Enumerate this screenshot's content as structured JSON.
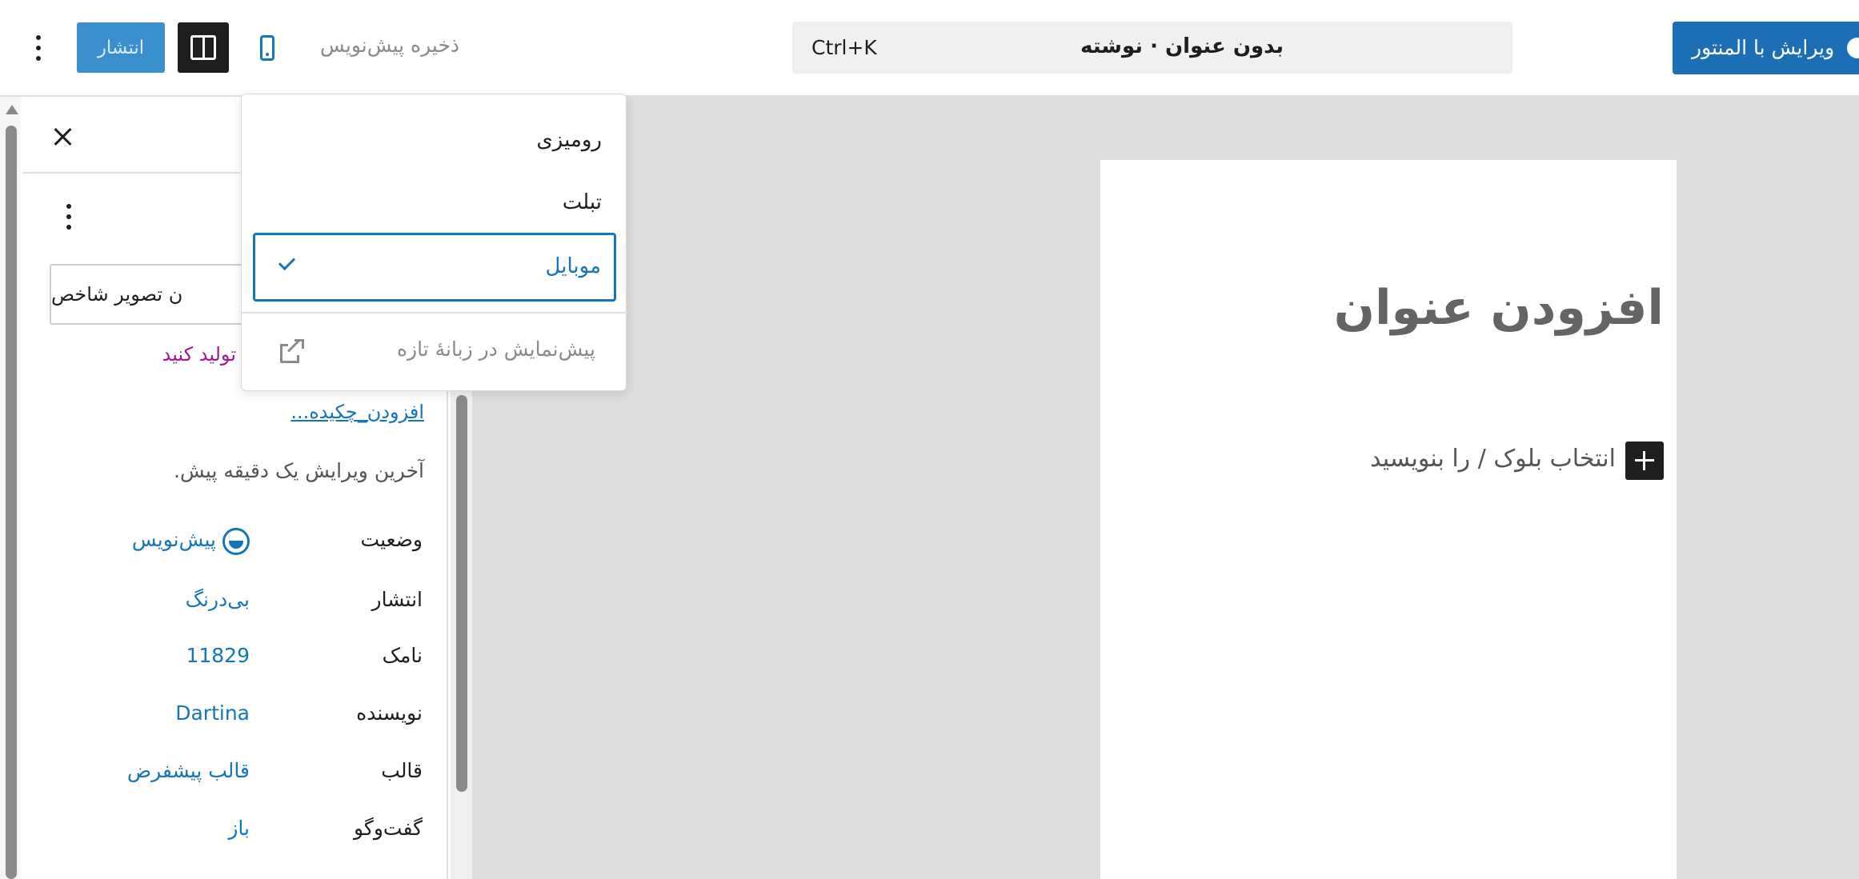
{
  "toolbar": {
    "publish_label": "انتشار",
    "save_draft_label": "ذخیره پیش‌نویس",
    "command_bar": {
      "shortcut": "Ctrl+K",
      "title": "بدون عنوان · نوشته"
    },
    "elementor_label": "ویرایش با المنتور",
    "colors": {
      "publish_bg": "#3a8fcf",
      "elementor_bg": "#1d6fb5",
      "accent": "#1476b8"
    }
  },
  "device_menu": {
    "items": [
      {
        "label": "رومیزی",
        "selected": false
      },
      {
        "label": "تبلت",
        "selected": false
      },
      {
        "label": "موبایل",
        "selected": true
      }
    ],
    "preview_new_tab": "پیش‌نمایش در زبانهٔ تازه"
  },
  "sidebar": {
    "featured_image_label": "ن تصویر شاخص",
    "generate_link": "تولید کنید",
    "add_excerpt": "افزودن_چکیده...",
    "last_edited": "آخرین ویرایش یک دقیقه پیش.",
    "meta": [
      {
        "label": "وضعیت",
        "value": "پیش‌نویس"
      },
      {
        "label": "انتشار",
        "value": "بی‌درنگ"
      },
      {
        "label": "نامک",
        "value": "11829"
      },
      {
        "label": "نویسنده",
        "value": "Dartina"
      },
      {
        "label": "قالب",
        "value": "قالب پیشفرض"
      },
      {
        "label": "گفت‌وگو",
        "value": "باز"
      }
    ]
  },
  "canvas": {
    "post_title_placeholder": "افزودن عنوان",
    "block_placeholder": "انتخاب بلوک / را بنویسید"
  }
}
